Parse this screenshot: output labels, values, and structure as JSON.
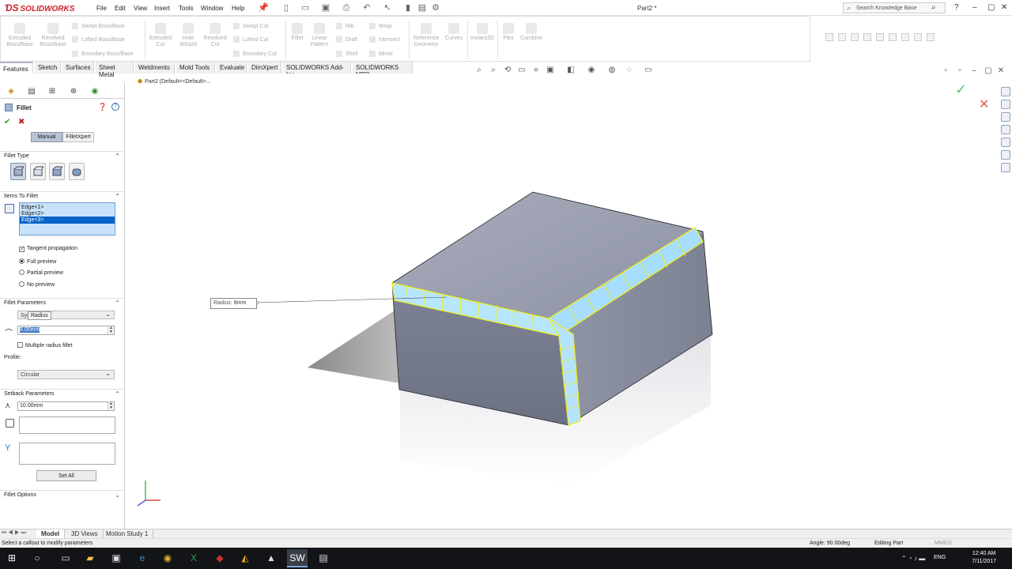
{
  "app": {
    "logo": "SOLIDWORKS",
    "doc_title": "Part2 *"
  },
  "menu": [
    "File",
    "Edit",
    "View",
    "Insert",
    "Tools",
    "Window",
    "Help"
  ],
  "search": {
    "placeholder": "Search Knowledge Base"
  },
  "commands": {
    "big": [
      {
        "name": "extruded-boss",
        "label": "Extruded Boss/Base"
      },
      {
        "name": "revolved-boss",
        "label": "Revolved Boss/Base"
      },
      {
        "name": "extruded-cut",
        "label": "Extruded Cut"
      },
      {
        "name": "hole-wizard",
        "label": "Hole Wizard"
      },
      {
        "name": "revolved-cut",
        "label": "Revolved Cut"
      },
      {
        "name": "fillet",
        "label": "Fillet"
      },
      {
        "name": "linear-pattern",
        "label": "Linear Pattern"
      },
      {
        "name": "reference-geometry",
        "label": "Reference Geometry"
      },
      {
        "name": "curves",
        "label": "Curves"
      },
      {
        "name": "instant3d",
        "label": "Instant3D"
      },
      {
        "name": "flex",
        "label": "Flex"
      },
      {
        "name": "combine",
        "label": "Combine"
      }
    ],
    "small": [
      {
        "name": "swept-boss",
        "label": "Swept Boss/Base"
      },
      {
        "name": "lofted-boss",
        "label": "Lofted Boss/Base"
      },
      {
        "name": "boundary-boss",
        "label": "Boundary Boss/Base"
      },
      {
        "name": "swept-cut",
        "label": "Swept Cut"
      },
      {
        "name": "lofted-cut",
        "label": "Lofted Cut"
      },
      {
        "name": "boundary-cut",
        "label": "Boundary Cut"
      },
      {
        "name": "rib",
        "label": "Rib"
      },
      {
        "name": "draft",
        "label": "Draft"
      },
      {
        "name": "shell",
        "label": "Shell"
      },
      {
        "name": "wrap",
        "label": "Wrap"
      },
      {
        "name": "intersect",
        "label": "Intersect"
      },
      {
        "name": "mirror",
        "label": "Mirror"
      }
    ]
  },
  "tabs": [
    "Features",
    "Sketch",
    "Surfaces",
    "Sheet Metal",
    "Weldments",
    "Mold Tools",
    "Evaluate",
    "DimXpert",
    "SOLIDWORKS Add-Ins",
    "SOLIDWORKS MBD"
  ],
  "breadcrumb": "Part2  (Default<<Default>...",
  "property": {
    "title": "Fillet",
    "mode_tabs": [
      "Manual",
      "FilletXpert"
    ],
    "fillet_type": {
      "header": "Fillet Type"
    },
    "items": {
      "header": "Items To Fillet",
      "edges": [
        "Edge<1>",
        "Edge<2>",
        "Edge<3>"
      ],
      "tangent": "Tangent propagation",
      "full": "Full preview",
      "partial": "Partial preview",
      "none": "No preview"
    },
    "params": {
      "header": "Fillet Parameters",
      "method": "Sym",
      "tooltip": "Radius",
      "radius": "8.00mm",
      "multiple": "Multiple radius fillet",
      "profile_label": "Profile:",
      "profile": "Circular"
    },
    "setback": {
      "header": "Setback Parameters",
      "distance": "10.00mm",
      "button": "Set All"
    },
    "options": {
      "header": "Fillet Options"
    }
  },
  "callout": {
    "label": "Radius:",
    "value": "8mm"
  },
  "bottom_tabs": [
    "Model",
    "3D Views",
    "Motion Study 1"
  ],
  "status": {
    "message": "Select a callout to modify parameters",
    "angle": "Angle: 90.00deg",
    "mode": "Editing Part",
    "units": "MMGS"
  },
  "taskbar": {
    "lang": "ENG",
    "time": "12:40 AM",
    "date": "7/11/2017"
  },
  "colors": {
    "highlight": "#f2f016",
    "model_face": "#8e93a6",
    "accent": "#d0202a"
  }
}
